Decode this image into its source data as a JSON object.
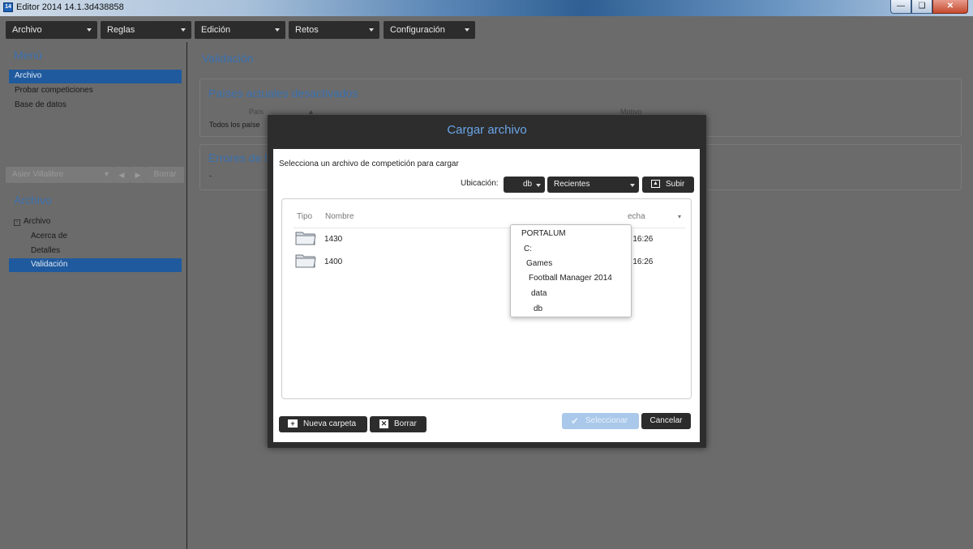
{
  "window": {
    "title": "Editor 2014 14.1.3d438858",
    "icon_text": "14"
  },
  "menubar": [
    {
      "label": "Archivo"
    },
    {
      "label": "Reglas"
    },
    {
      "label": "Edición"
    },
    {
      "label": "Retos"
    },
    {
      "label": "Configuración"
    }
  ],
  "sidebar": {
    "menu_heading": "Menú",
    "menu_items": [
      "Archivo",
      "Probar competiciones",
      "Base de datos"
    ],
    "user": "Asier Villalibre",
    "borrar_label": "Borrar",
    "archivo_heading": "Archivo",
    "tree_root": "Archivo",
    "tree_items": [
      "Acerca de",
      "Detalles",
      "Validación"
    ]
  },
  "content": {
    "heading": "Validación",
    "panel1": {
      "title": "Países actuales desactivados",
      "col_pais": "País",
      "col_motivo": "Motivo",
      "row_text": "Todos los paíse"
    },
    "panel2": {
      "title": "Errores de li",
      "value": "-"
    }
  },
  "dialog": {
    "title": "Cargar archivo",
    "instruction": "Selecciona un archivo de competición para cargar",
    "location_label": "Ubicación:",
    "location_value": "db",
    "recent_label": "Recientes",
    "up_label": "Subir",
    "columns": {
      "tipo": "Tipo",
      "nombre": "Nombre",
      "fecha": "echa"
    },
    "files": [
      {
        "name": "1430",
        "date": "4 16:26"
      },
      {
        "name": "1400",
        "date": "4 16:26"
      }
    ],
    "path_items": [
      "PORTALUM",
      "C:",
      "Games",
      "Football Manager 2014",
      "data",
      "db"
    ],
    "new_folder_label": "Nueva carpeta",
    "delete_label": "Borrar",
    "select_label": "Seleccionar",
    "cancel_label": "Cancelar"
  }
}
